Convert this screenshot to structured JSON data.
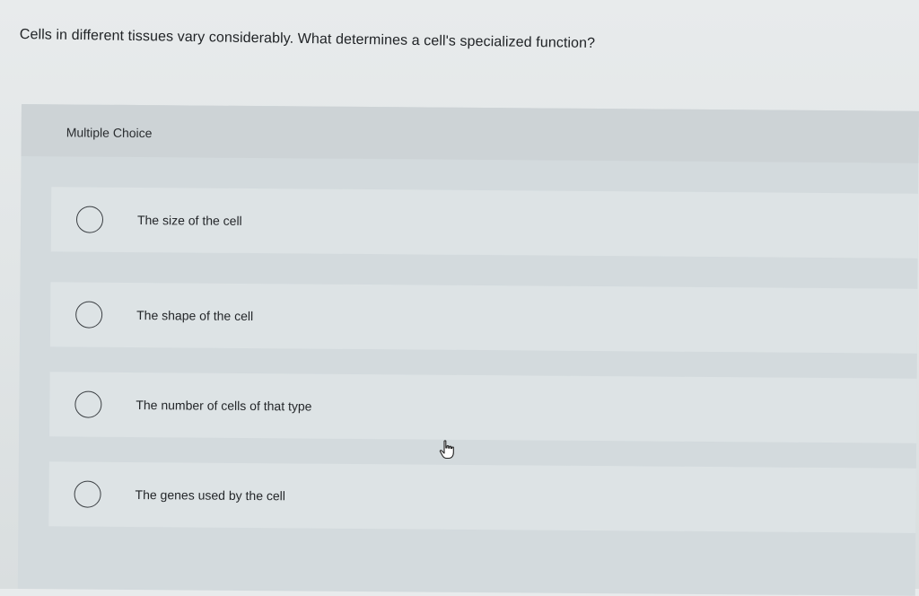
{
  "question": {
    "text": "Cells in different tissues vary considerably. What determines a cell's specialized function?"
  },
  "panel": {
    "title": "Multiple Choice",
    "options": [
      {
        "label": "The size of the cell"
      },
      {
        "label": "The shape of the cell"
      },
      {
        "label": "The number of cells of that type"
      },
      {
        "label": "The genes used by the cell"
      }
    ]
  },
  "icons": {
    "cursor": "hand-pointer-icon",
    "radio": "radio-unchecked-icon"
  },
  "colors": {
    "background": "#e3e7e8",
    "panel": "#d3dadd",
    "option": "#dde3e5"
  }
}
